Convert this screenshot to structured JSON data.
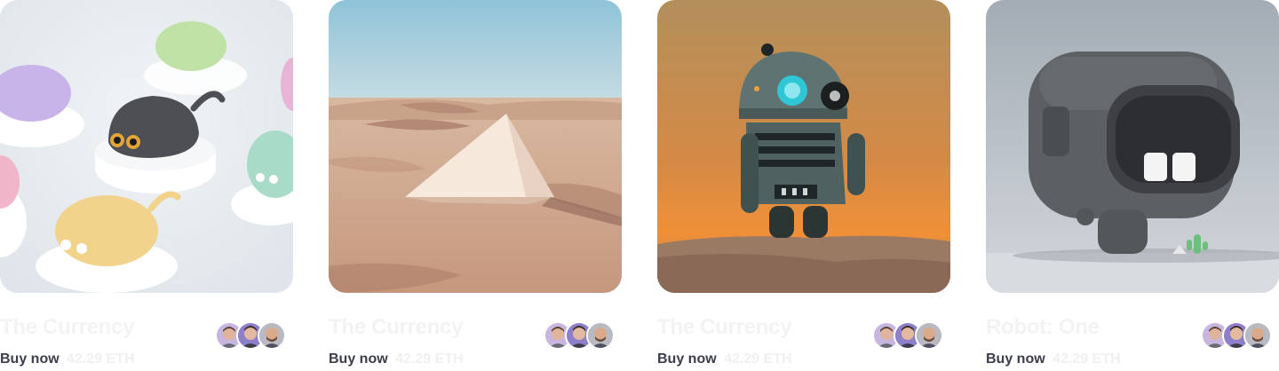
{
  "cards": [
    {
      "image": "cat-figurines-artwork",
      "title": "The Currency",
      "buy_label": "Buy now",
      "price": "42.29 ETH",
      "owners": [
        "avatar-owner-1",
        "avatar-owner-2",
        "avatar-owner-3"
      ]
    },
    {
      "image": "desert-pyramid-artwork",
      "title": "The Currency",
      "buy_label": "Buy now",
      "price": "42.29 ETH",
      "owners": [
        "avatar-owner-1",
        "avatar-owner-2",
        "avatar-owner-3"
      ]
    },
    {
      "image": "robot-desert-artwork",
      "title": "The Currency",
      "buy_label": "Buy now",
      "price": "42.29 ETH",
      "owners": [
        "avatar-owner-1",
        "avatar-owner-2",
        "avatar-owner-3"
      ]
    },
    {
      "image": "robot-one-artwork",
      "title": "Robot: One",
      "buy_label": "Buy now",
      "price": "42.29 ETH",
      "owners": [
        "avatar-owner-1",
        "avatar-owner-2",
        "avatar-owner-3"
      ]
    }
  ],
  "colors": {
    "title": "#f2f3f5",
    "buy": "#3a3f4b",
    "price": "#eef0f2",
    "avatar_bg_1": "#c7b6e0",
    "avatar_bg_2": "#8d7fc9",
    "avatar_bg_3": "#b9b9c2"
  }
}
